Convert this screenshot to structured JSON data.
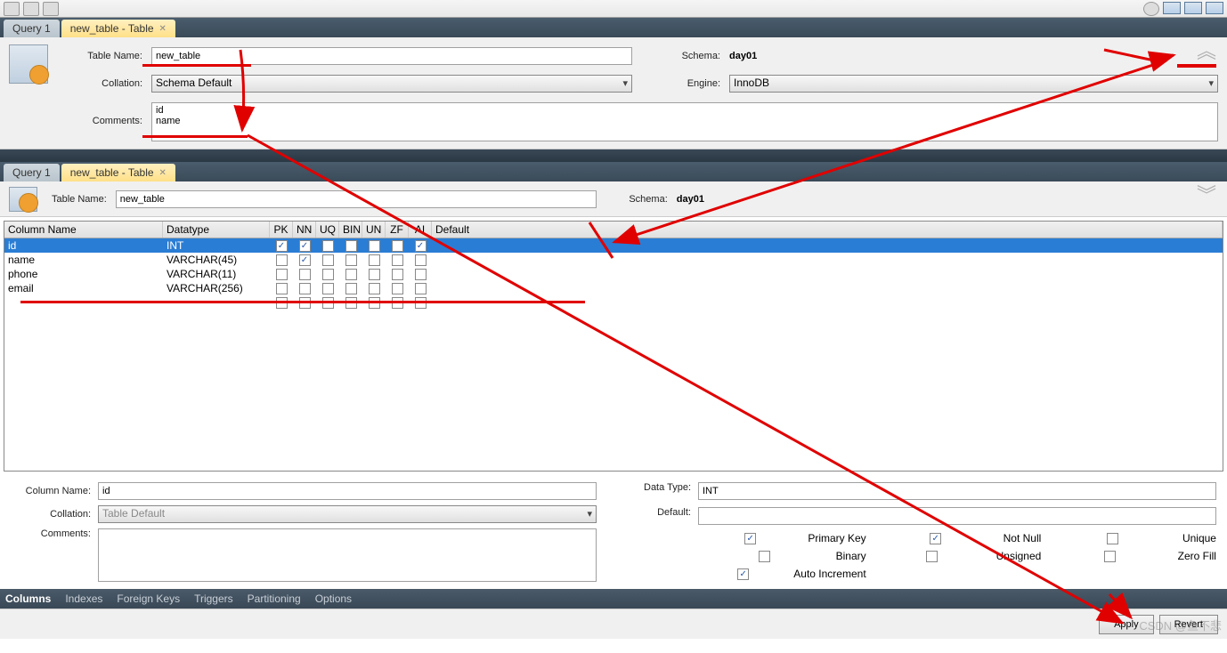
{
  "toolbar": {
    "icons": [
      "new",
      "run",
      "view"
    ]
  },
  "tabs1": {
    "t1": "Query 1",
    "t2": "new_table - Table"
  },
  "tabs2": {
    "t1": "Query 1",
    "t2": "new_table - Table"
  },
  "form1": {
    "table_name_label": "Table Name:",
    "table_name": "new_table",
    "schema_label": "Schema:",
    "schema": "day01",
    "collation_label": "Collation:",
    "collation": "Schema Default",
    "engine_label": "Engine:",
    "engine": "InnoDB",
    "comments_label": "Comments:",
    "comments": "id\nname"
  },
  "form2": {
    "table_name_label": "Table Name:",
    "table_name": "new_table",
    "schema_label": "Schema:",
    "schema": "day01"
  },
  "grid": {
    "headers": {
      "col": "Column Name",
      "dt": "Datatype",
      "pk": "PK",
      "nn": "NN",
      "uq": "UQ",
      "bin": "BIN",
      "un": "UN",
      "zf": "ZF",
      "ai": "AI",
      "def": "Default"
    },
    "rows": [
      {
        "name": "id",
        "datatype": "INT",
        "pk": true,
        "nn": true,
        "uq": false,
        "bin": false,
        "un": false,
        "zf": false,
        "ai": true,
        "default": "",
        "selected": true
      },
      {
        "name": "name",
        "datatype": "VARCHAR(45)",
        "pk": false,
        "nn": true,
        "uq": false,
        "bin": false,
        "un": false,
        "zf": false,
        "ai": false,
        "default": ""
      },
      {
        "name": "phone",
        "datatype": "VARCHAR(11)",
        "pk": false,
        "nn": false,
        "uq": false,
        "bin": false,
        "un": false,
        "zf": false,
        "ai": false,
        "default": ""
      },
      {
        "name": "email",
        "datatype": "VARCHAR(256)",
        "pk": false,
        "nn": false,
        "uq": false,
        "bin": false,
        "un": false,
        "zf": false,
        "ai": false,
        "default": ""
      }
    ]
  },
  "detail": {
    "col_name_label": "Column Name:",
    "col_name": "id",
    "datatype_label": "Data Type:",
    "datatype": "INT",
    "collation_label": "Collation:",
    "collation": "Table Default",
    "default_label": "Default:",
    "default": "",
    "comments_label": "Comments:",
    "comments": "",
    "flags": {
      "pk": {
        "label": "Primary Key",
        "on": true
      },
      "nn": {
        "label": "Not Null",
        "on": true
      },
      "uq": {
        "label": "Unique",
        "on": false
      },
      "bin": {
        "label": "Binary",
        "on": false
      },
      "un": {
        "label": "Unsigned",
        "on": false
      },
      "zf": {
        "label": "Zero Fill",
        "on": false
      },
      "ai": {
        "label": "Auto Increment",
        "on": true
      }
    }
  },
  "bottom_tabs": {
    "t1": "Columns",
    "t2": "Indexes",
    "t3": "Foreign Keys",
    "t4": "Triggers",
    "t5": "Partitioning",
    "t6": "Options"
  },
  "footer": {
    "apply": "Apply",
    "revert": "Revert"
  },
  "watermark": "CSDN @鱼不悲"
}
